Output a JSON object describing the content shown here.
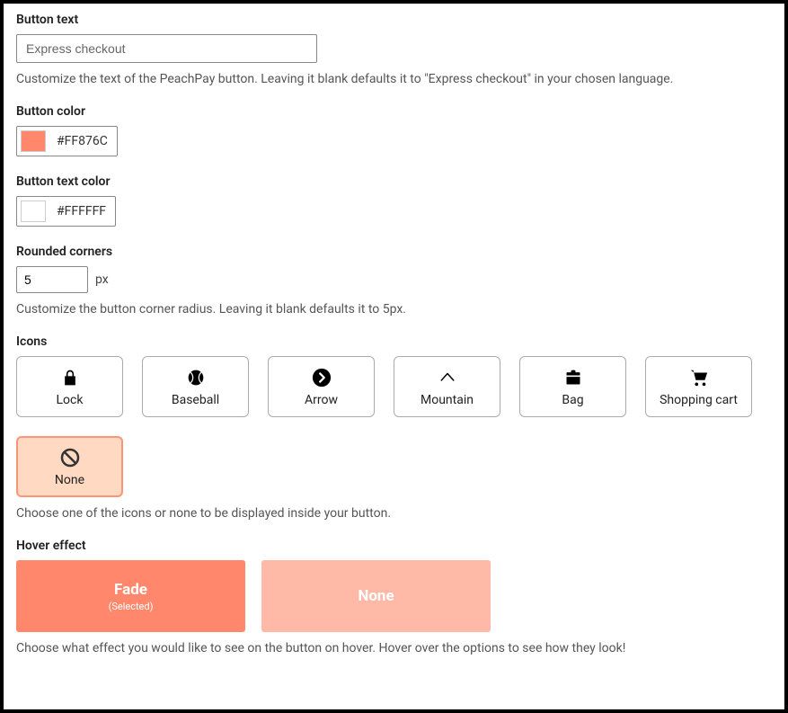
{
  "button_text": {
    "label": "Button text",
    "placeholder": "Express checkout",
    "value": "",
    "help": "Customize the text of the PeachPay button. Leaving it blank defaults it to \"Express checkout\" in your chosen language."
  },
  "button_color": {
    "label": "Button color",
    "value": "#FF876C",
    "swatch": "#FF876C"
  },
  "button_text_color": {
    "label": "Button text color",
    "value": "#FFFFFF",
    "swatch": "#FFFFFF"
  },
  "rounded": {
    "label": "Rounded corners",
    "value": "5",
    "unit": "px",
    "help": "Customize the button corner radius. Leaving it blank defaults it to 5px."
  },
  "icons": {
    "label": "Icons",
    "options": [
      {
        "id": "lock",
        "label": "Lock"
      },
      {
        "id": "baseball",
        "label": "Baseball"
      },
      {
        "id": "arrow",
        "label": "Arrow"
      },
      {
        "id": "mountain",
        "label": "Mountain"
      },
      {
        "id": "bag",
        "label": "Bag"
      },
      {
        "id": "cart",
        "label": "Shopping cart"
      },
      {
        "id": "none",
        "label": "None"
      }
    ],
    "selected": "none",
    "help": "Choose one of the icons or none to be displayed inside your button."
  },
  "hover": {
    "label": "Hover effect",
    "options": [
      {
        "id": "fade",
        "label": "Fade",
        "sub": "(Selected)"
      },
      {
        "id": "none",
        "label": "None",
        "sub": ""
      }
    ],
    "selected": "fade",
    "help": "Choose what effect you would like to see on the button on hover. Hover over the options to see how they look!"
  }
}
